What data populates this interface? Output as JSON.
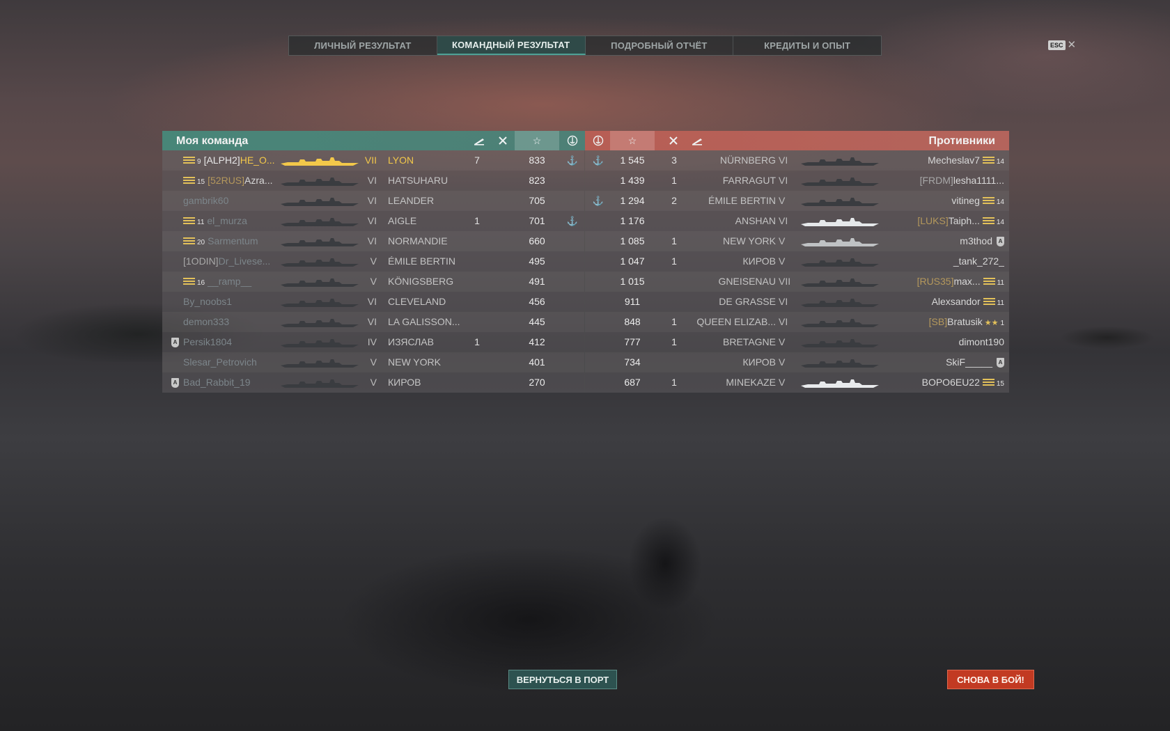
{
  "tabs": [
    {
      "label": "ЛИЧНЫЙ РЕЗУЛЬТАТ"
    },
    {
      "label": "КОМАНДНЫЙ РЕЗУЛЬТАТ",
      "active": true
    },
    {
      "label": "ПОДРОБНЫЙ ОТЧЁТ"
    },
    {
      "label": "КРЕДИТЫ И ОПЫТ"
    }
  ],
  "esc": {
    "key": "ESC",
    "close": "✕"
  },
  "my_team": {
    "title": "Моя команда",
    "header_icons": [
      "torpedo-icon",
      "plane-icon",
      "star-icon",
      "anchor-achievement-icon"
    ],
    "rows": [
      {
        "rank": "9",
        "clan": "[ALPH2]",
        "name": "HE_O...",
        "tier": "VII",
        "ship": "LYON",
        "a": "7",
        "score": "833",
        "ach": "⚓",
        "highlight": true,
        "stripe": "stripe",
        "ship_color": "#f2c84a"
      },
      {
        "rank": "15",
        "clan": "[52RUS]",
        "name": "Azra...",
        "tier": "VI",
        "ship": "HATSUHARU",
        "a": "",
        "score": "823",
        "ach": "",
        "clan_gold": true,
        "stripe": "stripe"
      },
      {
        "rank": "",
        "clan": "",
        "name": "gambrik60",
        "tier": "VI",
        "ship": "LEANDER",
        "a": "",
        "score": "705",
        "ach": "",
        "dim": true
      },
      {
        "rank": "11",
        "clan": "",
        "name": "el_murza",
        "tier": "VI",
        "ship": "AIGLE",
        "a": "1",
        "score": "701",
        "ach": "⚓",
        "dim": true,
        "stripe": "stripe"
      },
      {
        "rank": "20",
        "clan": "",
        "name": "Sarmentum",
        "tier": "VI",
        "ship": "NORMANDIE",
        "a": "",
        "score": "660",
        "ach": "",
        "dim": true,
        "stripe": "stripe"
      },
      {
        "rank": "",
        "clan": "[1ODIN]",
        "name": "Dr_Livese...",
        "tier": "V",
        "ship": "ÉMILE BERTIN",
        "a": "",
        "score": "495",
        "ach": "",
        "dim": true
      },
      {
        "rank": "16",
        "clan": "",
        "name": "__ramp__",
        "tier": "V",
        "ship": "KÖNIGSBERG",
        "a": "",
        "score": "491",
        "ach": "",
        "dim": true,
        "stripe": "stripe"
      },
      {
        "rank": "",
        "clan": "",
        "name": "By_noobs1",
        "tier": "VI",
        "ship": "CLEVELAND",
        "a": "",
        "score": "456",
        "ach": "",
        "dim": true
      },
      {
        "rank": "",
        "clan": "",
        "name": "demon333",
        "tier": "VI",
        "ship": "LA GALISSON...",
        "a": "",
        "score": "445",
        "ach": "",
        "dim": true
      },
      {
        "rank": "",
        "clan": "",
        "name": "Persik1804",
        "tier": "IV",
        "ship": "ИЗЯСЛАВ",
        "a": "1",
        "score": "412",
        "ach": "",
        "dim": true,
        "shield": "A"
      },
      {
        "rank": "",
        "clan": "",
        "name": "Slesar_Petrovich",
        "tier": "V",
        "ship": "NEW YORK",
        "a": "",
        "score": "401",
        "ach": "",
        "dim": true
      },
      {
        "rank": "",
        "clan": "",
        "name": "Bad_Rabbit_19",
        "tier": "V",
        "ship": "КИРОВ",
        "a": "",
        "score": "270",
        "ach": "",
        "dim": true,
        "shield": "A"
      }
    ]
  },
  "enemy_team": {
    "title": "Противники",
    "header_icons": [
      "anchor-achievement-icon",
      "star-icon",
      "plane-icon",
      "torpedo-icon"
    ],
    "rows": [
      {
        "ach": "⚓",
        "score": "1 545",
        "a": "3",
        "ship": "NÜRNBERG",
        "tier": "VI",
        "clan": "",
        "name": "Mecheslav7",
        "rank": "14",
        "stripe": "stripe"
      },
      {
        "ach": "",
        "score": "1 439",
        "a": "1",
        "ship": "FARRAGUT",
        "tier": "VI",
        "clan": "[FRDM]",
        "name": "lesha1111...",
        "rank": ""
      },
      {
        "ach": "⚓",
        "score": "1 294",
        "a": "2",
        "ship": "ÉMILE BERTIN",
        "tier": "V",
        "clan": "",
        "name": "vitineg",
        "rank": "14",
        "stripe": "stripe"
      },
      {
        "ach": "",
        "score": "1 176",
        "a": "",
        "ship": "ANSHAN",
        "tier": "VI",
        "clan": "[LUKS]",
        "name": "Taiph...",
        "rank": "14",
        "clan_gold": true,
        "stripe": "stripe",
        "ship_color": "#e5e8ea"
      },
      {
        "ach": "",
        "score": "1 085",
        "a": "1",
        "ship": "NEW YORK",
        "tier": "V",
        "clan": "",
        "name": "m3thod",
        "rank": "",
        "shield": "A",
        "ship_color": "#bfc2c4"
      },
      {
        "ach": "",
        "score": "1 047",
        "a": "1",
        "ship": "КИРОВ",
        "tier": "V",
        "clan": "",
        "name": "_tank_272_",
        "rank": ""
      },
      {
        "ach": "",
        "score": "1 015",
        "a": "",
        "ship": "GNEISENAU",
        "tier": "VII",
        "clan": "[RUS35]",
        "name": "max...",
        "rank": "11",
        "clan_gold": true,
        "stripe": "stripe"
      },
      {
        "ach": "",
        "score": "911",
        "a": "",
        "ship": "DE GRASSE",
        "tier": "VI",
        "clan": "",
        "name": "Alexsandor",
        "rank": "11",
        "stripe": "stripe"
      },
      {
        "ach": "",
        "score": "848",
        "a": "1",
        "ship": "QUEEN ELIZAB...",
        "tier": "VI",
        "clan": "[SB]",
        "name": "Bratusik",
        "rank": "1",
        "clan_gold": true,
        "stripe": "star"
      },
      {
        "ach": "",
        "score": "777",
        "a": "1",
        "ship": "BRETAGNE",
        "tier": "V",
        "clan": "",
        "name": "dimont190",
        "rank": ""
      },
      {
        "ach": "",
        "score": "734",
        "a": "",
        "ship": "КИРОВ",
        "tier": "V",
        "clan": "",
        "name": "SkiF_____",
        "rank": "",
        "shield": "A"
      },
      {
        "ach": "",
        "score": "687",
        "a": "1",
        "ship": "MINEKAZE",
        "tier": "V",
        "clan": "",
        "name": "BOPO6EU22",
        "rank": "15",
        "stripe": "stripe",
        "ship_color": "#e8eaec"
      }
    ]
  },
  "buttons": {
    "port": "ВЕРНУТЬСЯ В ПОРТ",
    "battle": "СНОВА В БОЙ!"
  }
}
